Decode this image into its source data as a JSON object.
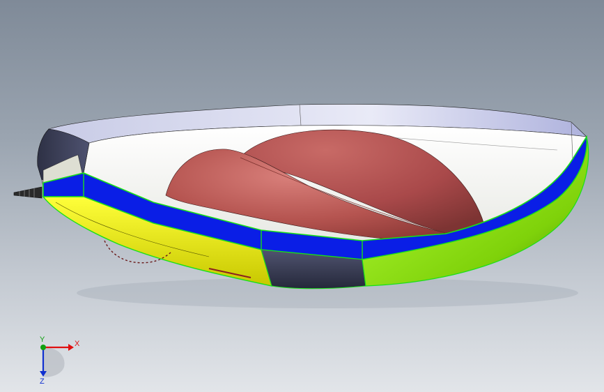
{
  "viewport": {
    "background_top": "#7f8a98",
    "background_bottom": "#e2e5e9"
  },
  "model": {
    "face_colors": {
      "white_top": "#f4f5f2",
      "blue_band": "#0a1ee6",
      "yellow_side": "#f2f20a",
      "green_side": "#8ee614",
      "dark_face": "#3a3d55",
      "red_hump": "#b5504d",
      "edge_highlight": "#1fe61f"
    }
  },
  "triad": {
    "x_label": "X",
    "y_label": "Y",
    "z_label": "Z",
    "x_color": "#e01010",
    "y_color": "#10a010",
    "z_color": "#1030d0"
  }
}
